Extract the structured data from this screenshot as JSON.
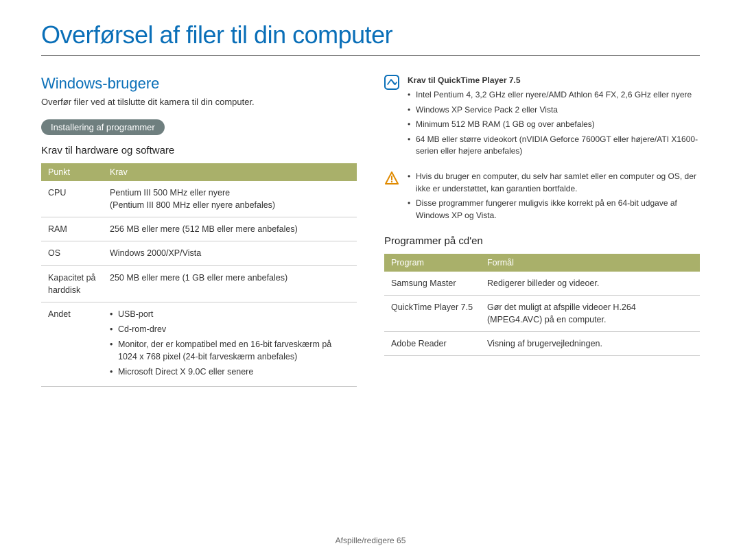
{
  "title": "Overførsel af filer til din computer",
  "left": {
    "section_title": "Windows-brugere",
    "intro": "Overfør filer ved at tilslutte dit kamera til din computer.",
    "pill": "Installering af programmer",
    "req_heading": "Krav til hardware og software",
    "req_table": {
      "headers": [
        "Punkt",
        "Krav"
      ],
      "rows": [
        {
          "label": "CPU",
          "value": "Pentium III 500 MHz eller nyere\n(Pentium III 800 MHz eller nyere anbefales)"
        },
        {
          "label": "RAM",
          "value": "256 MB eller mere (512 MB eller mere anbefales)"
        },
        {
          "label": "OS",
          "value": "Windows 2000/XP/Vista"
        },
        {
          "label": "Kapacitet på harddisk",
          "value": "250 MB eller mere (1 GB eller mere anbefales)"
        },
        {
          "label": "Andet",
          "list": [
            "USB-port",
            "Cd-rom-drev",
            "Monitor, der er kompatibel med en 16-bit farveskærm på 1024 x 768 pixel (24-bit farveskærm anbefales)",
            "Microsoft Direct X 9.0C eller senere"
          ]
        }
      ]
    }
  },
  "right": {
    "info_box": {
      "title": "Krav til QuickTime Player 7.5",
      "items": [
        "Intel Pentium 4, 3,2 GHz eller nyere/AMD Athlon 64 FX, 2,6 GHz eller nyere",
        "Windows XP Service Pack 2 eller Vista",
        "Minimum 512 MB RAM (1 GB og over anbefales)",
        "64 MB eller større videokort (nVIDIA Geforce 7600GT eller højere/ATI X1600-serien eller højere anbefales)"
      ]
    },
    "warn_box": {
      "items": [
        "Hvis du bruger en computer, du selv har samlet eller en computer og OS, der ikke er understøttet, kan garantien bortfalde.",
        "Disse programmer fungerer muligvis ikke korrekt på en 64-bit udgave af Windows XP og Vista."
      ]
    },
    "prog_heading": "Programmer på cd'en",
    "prog_table": {
      "headers": [
        "Program",
        "Formål"
      ],
      "rows": [
        {
          "label": "Samsung Master",
          "value": "Redigerer billeder og videoer."
        },
        {
          "label": "QuickTime Player 7.5",
          "value": "Gør det muligt at afspille videoer H.264 (MPEG4.AVC) på en computer."
        },
        {
          "label": "Adobe Reader",
          "value": "Visning af brugervejledningen."
        }
      ]
    }
  },
  "footer": {
    "section": "Afspille/redigere",
    "page": "65"
  }
}
